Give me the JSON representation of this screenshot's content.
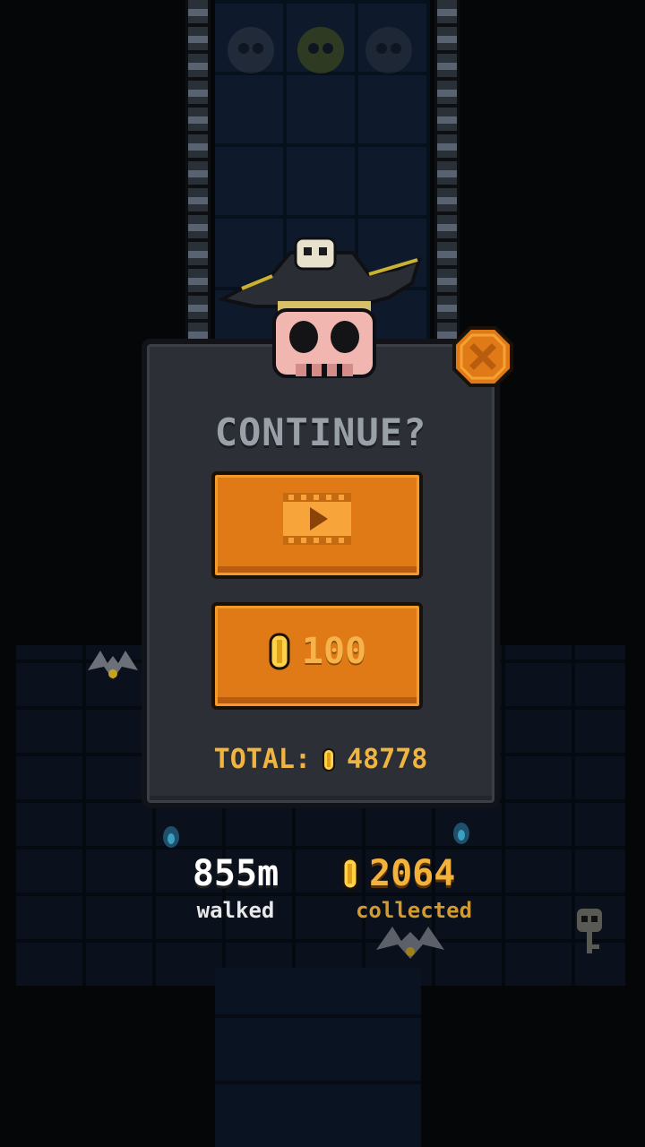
{
  "dialog": {
    "title": "CONTINUE?",
    "video_button_icon": "film-play-icon",
    "coin_cost": "100",
    "total_label": "TOTAL:",
    "total_coins": "48778",
    "close_icon": "close-x-icon"
  },
  "stats": {
    "distance": "855m",
    "distance_label": "walked",
    "coins_collected": "2064",
    "coins_label": "collected"
  },
  "colors": {
    "button_orange": "#e07a17",
    "panel": "#2c2f36",
    "gold": "#f5b23a"
  }
}
